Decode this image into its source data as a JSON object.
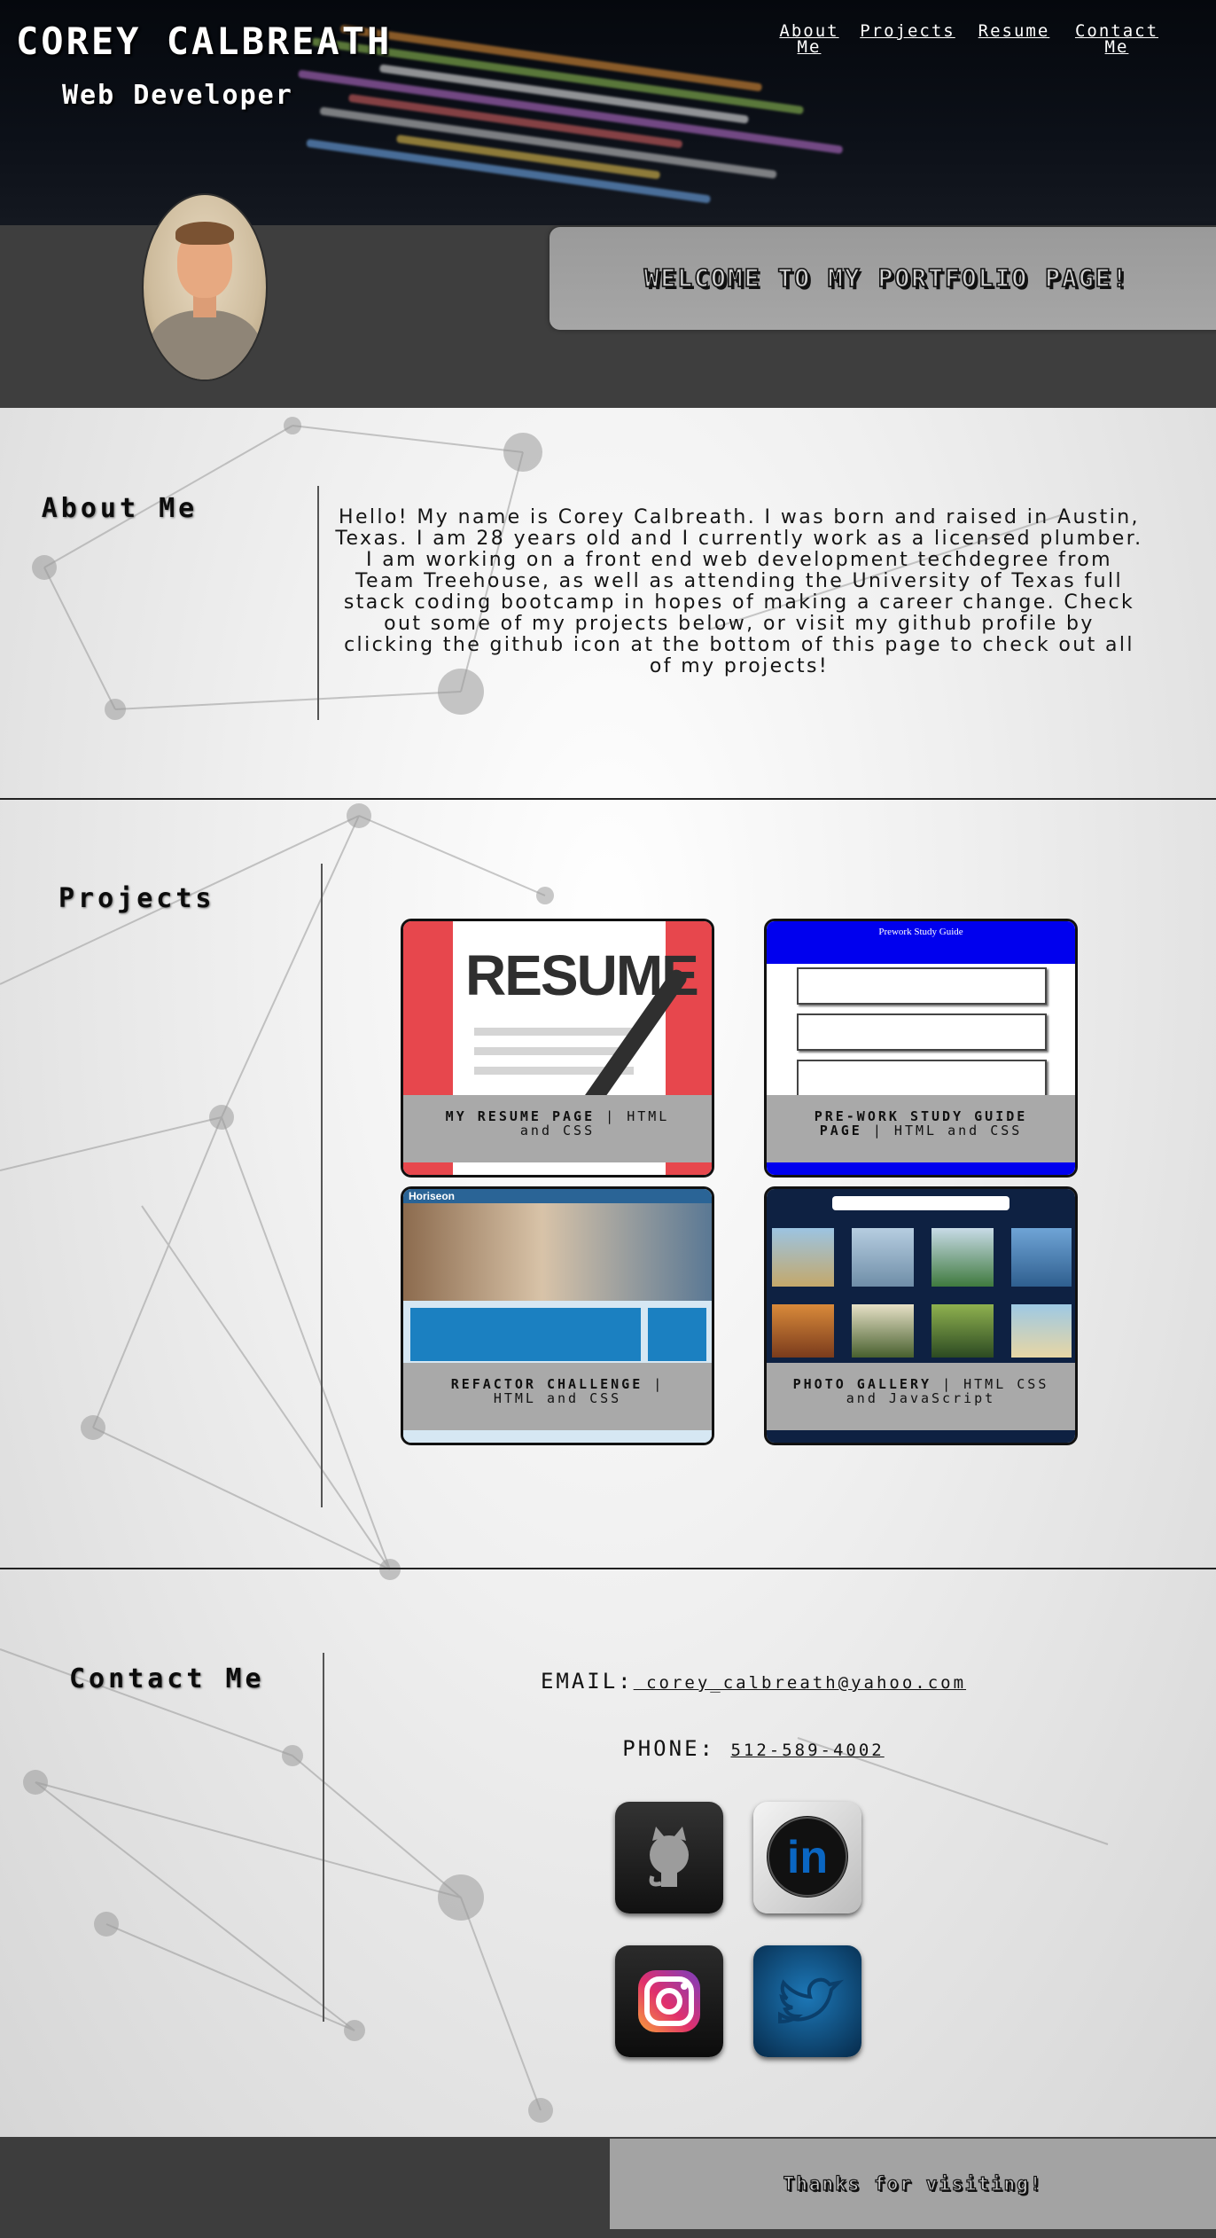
{
  "header": {
    "name": "COREY CALBREATH",
    "role": "Web Developer",
    "nav": [
      "About Me",
      "Projects",
      "Resume",
      "Contact Me"
    ]
  },
  "banner": {
    "welcome": "WELCOME TO MY PORTFOLIO PAGE!"
  },
  "about": {
    "title": "About Me",
    "text": "Hello! My name is Corey Calbreath. I was born and raised in Austin, Texas. I am 28 years old and I currently work as a licensed plumber. I am working on a front end web development techdegree from Team Treehouse, as well as attending the University of Texas full stack coding bootcamp in hopes of making a career change. Check out some of my projects below, or visit my github profile by clicking the github icon at the bottom of this page to check out all of my projects!"
  },
  "projects": {
    "title": "Projects",
    "items": [
      {
        "name": "MY RESUME PAGE",
        "tech": "| HTML and CSS",
        "thumb_text": "RESUME"
      },
      {
        "name": "PRE-WORK STUDY GUIDE PAGE",
        "tech": "| HTML and CSS",
        "thumb_text": "Prework Study Guide"
      },
      {
        "name": "REFACTOR CHALLENGE",
        "tech": "| HTML and CSS",
        "thumb_text": "Horiseon"
      },
      {
        "name": "PHOTO GALLERY",
        "tech": "| HTML CSS and JavaScript",
        "thumb_text": ""
      }
    ]
  },
  "contact": {
    "title": "Contact Me",
    "email_label": "EMAIL:",
    "email": " corey_calbreath@yahoo.com",
    "phone_label": "PHONE:",
    "phone": "512-589-4002",
    "socials": [
      "github-icon",
      "linkedin-icon",
      "instagram-icon",
      "twitter-icon"
    ]
  },
  "footer": {
    "text": "Thanks for visiting!"
  },
  "colors": {
    "accent_blue": "#0a66c2",
    "band": "#3e3e3e",
    "panel": "#a3a3a3"
  }
}
